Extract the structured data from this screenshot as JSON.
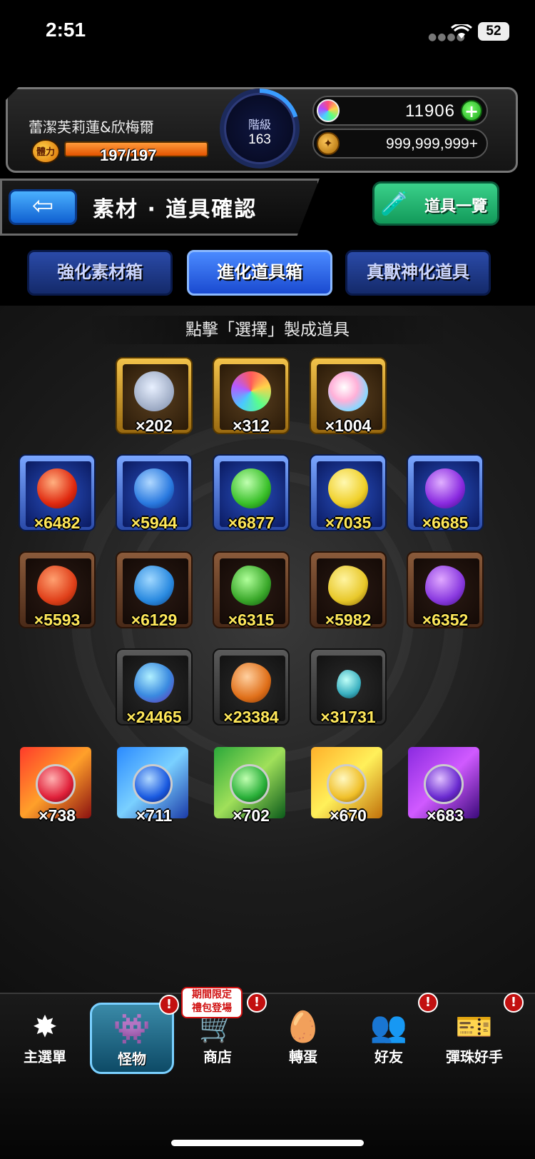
{
  "status_bar": {
    "time": "2:51",
    "battery": "52"
  },
  "header": {
    "player_name": "蕾潔芙莉蓮&欣梅爾",
    "stamina_label": "體力",
    "stamina_text": "197/197",
    "stamina_fraction": 1.0,
    "rank_label": "階級",
    "rank_value": "163",
    "gems": "11906",
    "coins": "999,999,999+"
  },
  "title_bar": {
    "title": "素材 · 道具確認",
    "item_list_label": "道具一覽"
  },
  "tabs": [
    {
      "label": "強化素材箱",
      "active": false
    },
    {
      "label": "進化道具箱",
      "active": true
    },
    {
      "label": "真獸神化道具",
      "active": false
    }
  ],
  "instruction": "點擊「選擇」製成道具",
  "items": [
    {
      "qty": "×202",
      "frame": "gold",
      "icon": "crest-icon"
    },
    {
      "qty": "×312",
      "frame": "gold",
      "icon": "rainbow-orb-icon"
    },
    {
      "qty": "×1004",
      "frame": "gold",
      "icon": "rainbow-sphere-icon"
    },
    {
      "qty": "×6482",
      "frame": "blue",
      "icon": "red-orb-icon"
    },
    {
      "qty": "×5944",
      "frame": "blue",
      "icon": "blue-orb-icon"
    },
    {
      "qty": "×6877",
      "frame": "blue",
      "icon": "green-orb-icon"
    },
    {
      "qty": "×7035",
      "frame": "blue",
      "icon": "yellow-orb-icon"
    },
    {
      "qty": "×6685",
      "frame": "blue",
      "icon": "purple-orb-icon"
    },
    {
      "qty": "×5593",
      "frame": "brown",
      "icon": "red-stone-icon"
    },
    {
      "qty": "×6129",
      "frame": "brown",
      "icon": "blue-stone-icon"
    },
    {
      "qty": "×6315",
      "frame": "brown",
      "icon": "green-stone-icon"
    },
    {
      "qty": "×5982",
      "frame": "brown",
      "icon": "yellow-stone-icon"
    },
    {
      "qty": "×6352",
      "frame": "brown",
      "icon": "purple-stone-icon"
    },
    {
      "qty": "×24465",
      "frame": "gray",
      "icon": "large-crystal-icon"
    },
    {
      "qty": "×23384",
      "frame": "gray",
      "icon": "orange-crystal-icon"
    },
    {
      "qty": "×31731",
      "frame": "gray",
      "icon": "small-crystal-icon"
    },
    {
      "qty": "×738",
      "frame": "beast",
      "icon": "fire-beast-egg-icon"
    },
    {
      "qty": "×711",
      "frame": "beast",
      "icon": "water-beast-egg-icon"
    },
    {
      "qty": "×702",
      "frame": "beast",
      "icon": "wood-beast-egg-icon"
    },
    {
      "qty": "×670",
      "frame": "beast",
      "icon": "light-beast-egg-icon"
    },
    {
      "qty": "×683",
      "frame": "beast",
      "icon": "dark-beast-egg-icon"
    }
  ],
  "nav": [
    {
      "label": "主選單",
      "icon": "main-menu-icon",
      "badge": false,
      "active": false
    },
    {
      "label": "怪物",
      "icon": "monster-icon",
      "badge": true,
      "active": true
    },
    {
      "label": "商店",
      "icon": "shop-cart-icon",
      "badge": true,
      "active": false
    },
    {
      "label": "轉蛋",
      "icon": "gacha-egg-icon",
      "badge": false,
      "active": false
    },
    {
      "label": "好友",
      "icon": "friends-icon",
      "badge": true,
      "active": false
    },
    {
      "label": "彈珠好手",
      "icon": "strike-card-icon",
      "badge": true,
      "active": false
    }
  ],
  "shop_promo": "期間限定\n禮包登場",
  "badge_mark": "!",
  "colors": {
    "red": "#ff4a2a",
    "blue": "#3a9cff",
    "green": "#3ad04a",
    "yellow": "#ffd23a",
    "purple": "#a04aff"
  }
}
